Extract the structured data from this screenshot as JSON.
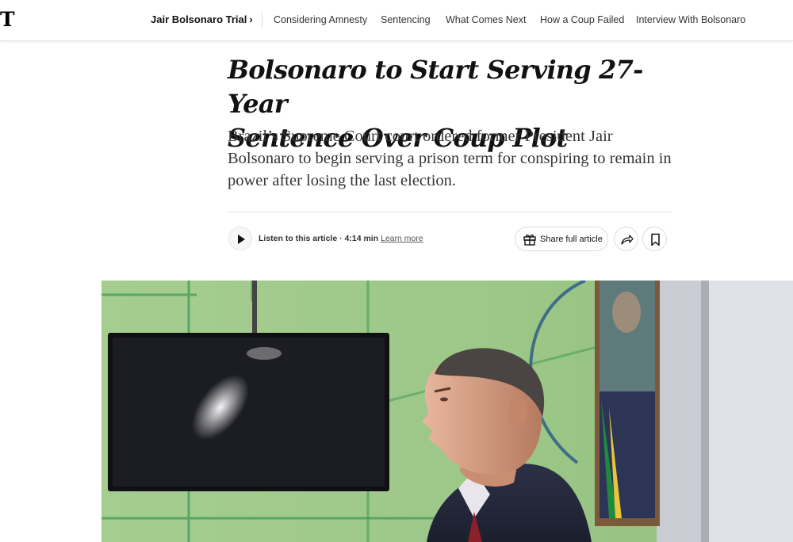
{
  "header": {
    "logo_text": "T",
    "primary_link": "Jair Bolsonaro Trial",
    "primary_chevron": "›",
    "links": [
      "Considering Amnesty",
      "Sentencing",
      "What Comes Next",
      "How a Coup Failed",
      "Interview With Bolsonaro"
    ]
  },
  "article": {
    "headline_line1": "Bolsonaro to Start Serving 27-Year",
    "headline_line2": "Sentence Over Coup Plot",
    "summary": "Brazil’s Supreme Court court ordered former President Jair Bolsonaro to begin serving a prison term for conspiring to remain in power after losing the last election."
  },
  "audio": {
    "listen_label": "Listen to this article · 4:14 min",
    "learn_more": "Learn more"
  },
  "actions": {
    "share_label": "Share full article"
  },
  "icons": {
    "logo": "nyt-logo-icon",
    "play": "play-icon",
    "gift": "gift-icon",
    "share": "share-arrow-icon",
    "bookmark": "bookmark-icon"
  }
}
